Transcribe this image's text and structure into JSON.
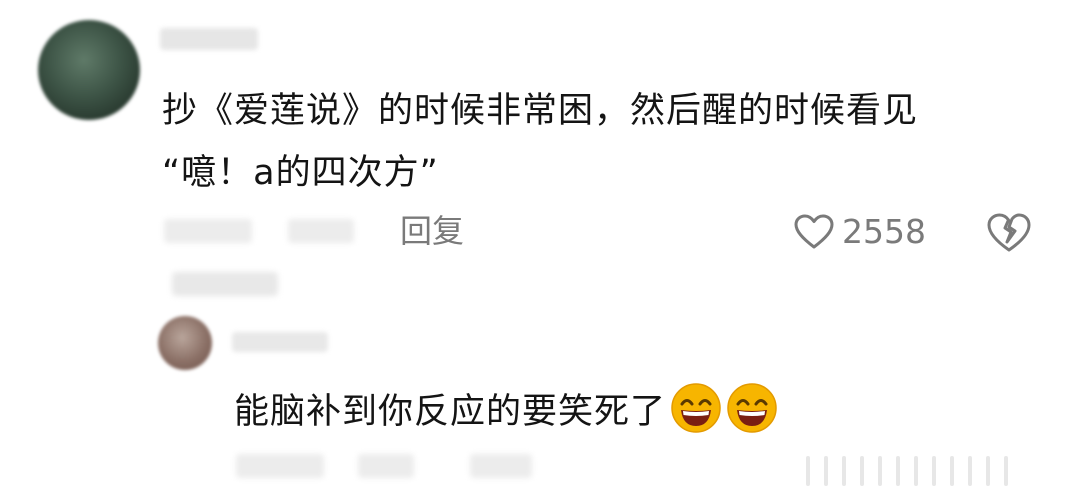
{
  "comment": {
    "text_lines": [
      "抄《爱莲说》的时候非常困，然后醒的时候看见",
      "“噫！a的四次方”"
    ],
    "reply_label": "回复",
    "likes": "2558",
    "icons": {
      "like": "heart-outline-icon",
      "dislike": "broken-heart-icon"
    }
  },
  "reply": {
    "text": "能脑补到你反应的要笑死了",
    "emojis": [
      "grinning-face-emoji",
      "grinning-face-emoji"
    ]
  },
  "colors": {
    "text": "#141414",
    "meta": "#7a7a7a",
    "emoji": "#f7b500"
  }
}
